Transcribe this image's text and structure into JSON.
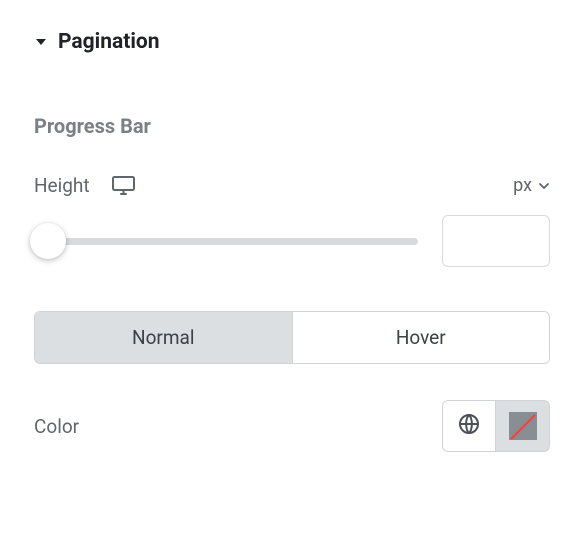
{
  "section": {
    "title": "Pagination"
  },
  "progress_bar": {
    "title": "Progress Bar",
    "height": {
      "label": "Height",
      "unit": "px",
      "value": ""
    },
    "tabs": {
      "normal": "Normal",
      "hover": "Hover",
      "active": "normal"
    },
    "color": {
      "label": "Color"
    }
  }
}
